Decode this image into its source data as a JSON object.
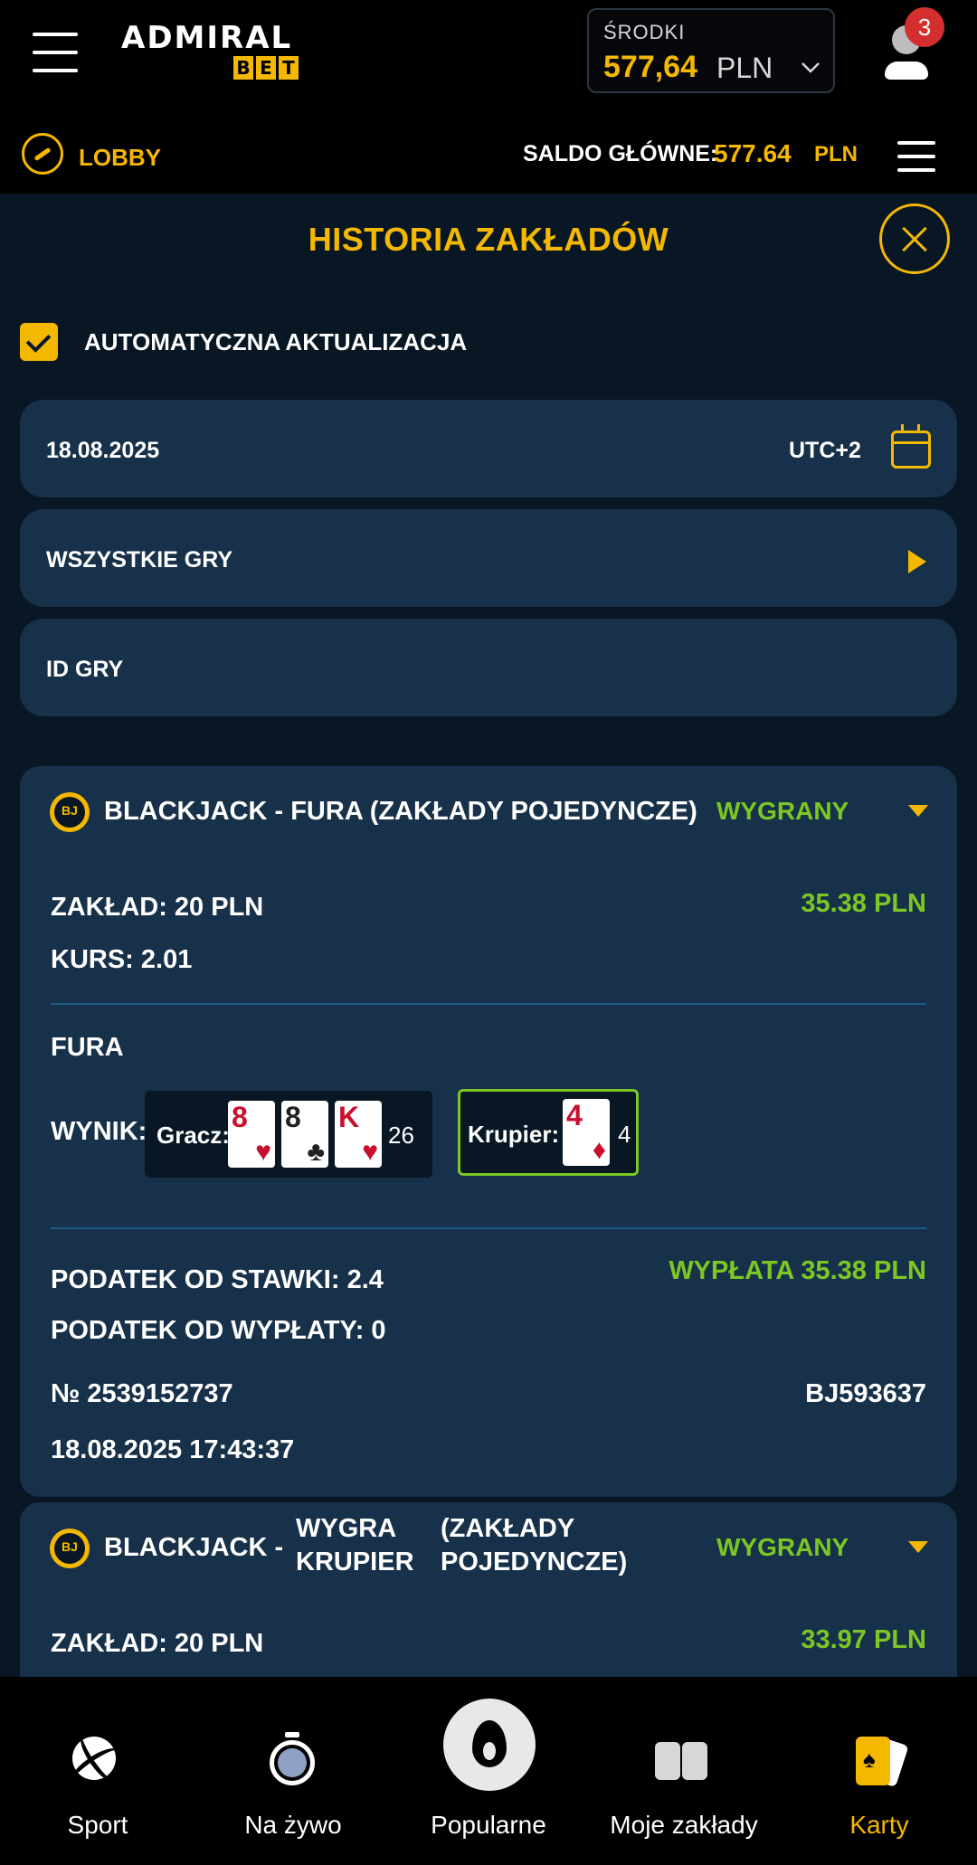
{
  "header": {
    "logo_text": "ADMIRAL",
    "logo_sub": [
      "B",
      "E",
      "T"
    ],
    "funds_label": "ŚRODKI",
    "funds_amount": "577,64",
    "funds_currency": "PLN",
    "notifications": "3"
  },
  "gamebar": {
    "lobby": "LOBBY",
    "saldo_label": "SALDO GŁÓWNE:",
    "saldo_value": "577.64",
    "saldo_currency": "PLN"
  },
  "history": {
    "title": "HISTORIA ZAKŁADÓW",
    "auto_update": "AUTOMATYCZNA AKTUALIZACJA",
    "auto_update_checked": true,
    "date": "18.08.2025",
    "timezone": "UTC+2",
    "games_filter": "WSZYSTKIE GRY",
    "game_id_placeholder": "ID GRY"
  },
  "bets": [
    {
      "icon_text": "BJ",
      "title": "BLACKJACK  -  FURA  (ZAKŁADY POJEDYNCZE)",
      "status": "WYGRANY",
      "stake": "ZAKŁAD:  20  PLN",
      "odds": "KURS:  2.01",
      "win_amount": "35.38  PLN",
      "bet_type": "FURA",
      "result_label": "WYNIK:",
      "player_label": "Gracz:",
      "player_cards": [
        {
          "rank": "8",
          "suit": "♥",
          "color": "red"
        },
        {
          "rank": "8",
          "suit": "♣",
          "color": "black"
        },
        {
          "rank": "K",
          "suit": "♥",
          "color": "red"
        }
      ],
      "player_total": "26",
      "dealer_label": "Krupier:",
      "dealer_cards": [
        {
          "rank": "4",
          "suit": "♦",
          "color": "red"
        }
      ],
      "dealer_total": "4",
      "tax_stake": "PODATEK OD STAWKI:  2.4",
      "tax_payout": "PODATEK OD WYPŁATY:  0",
      "payout": "WYPŁATA 35.38  PLN",
      "ticket_no": "№ 2539152737",
      "round_id": "BJ593637",
      "timestamp": "18.08.2025 17:43:37"
    },
    {
      "icon_text": "BJ",
      "title_part1": "BLACKJACK  -",
      "title_part2_line1": "WYGRA",
      "title_part2_line2": "KRUPIER",
      "title_part3_line1": "(ZAKŁADY",
      "title_part3_line2": "POJEDYNCZE)",
      "status": "WYGRANY",
      "stake": "ZAKŁAD:  20  PLN",
      "win_amount": "33.97  PLN"
    }
  ],
  "nav": {
    "items": [
      {
        "label": "Sport",
        "icon": "sport-ball-icon"
      },
      {
        "label": "Na żywo",
        "icon": "stopwatch-icon"
      },
      {
        "label": "Popularne",
        "icon": "flame-icon"
      },
      {
        "label": "Moje zakłady",
        "icon": "tickets-icon"
      },
      {
        "label": "Karty",
        "icon": "cards-icon"
      }
    ],
    "active": "Karty"
  },
  "colors": {
    "accent": "#f5b800",
    "win": "#7cc723",
    "panel_bg": "#081723",
    "card_bg": "#17314a"
  }
}
